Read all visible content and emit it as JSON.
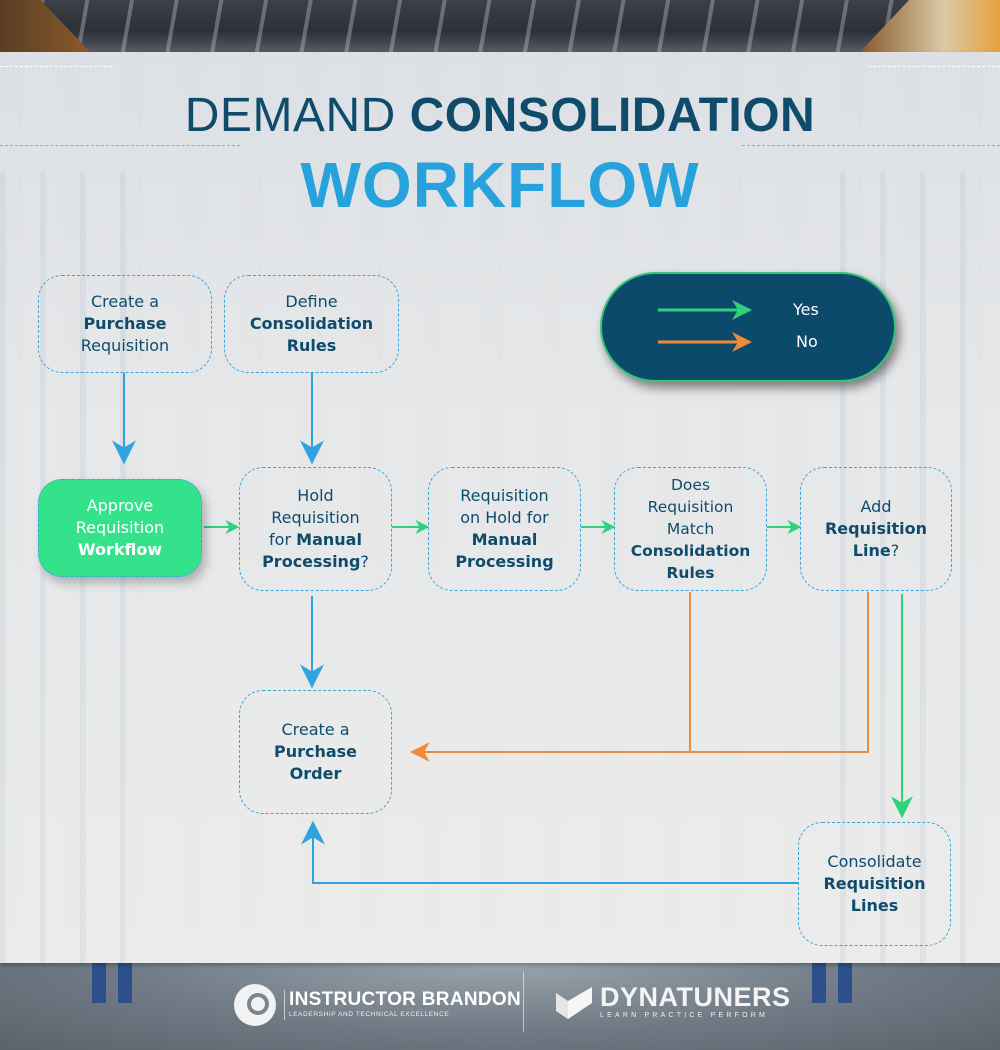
{
  "title": {
    "line1_light": "DEMAND",
    "line1_bold": "CONSOLIDATION",
    "line2": "WORKFLOW"
  },
  "colors": {
    "title_dark": "#0f4c6c",
    "title_accent": "#28a2dc",
    "flow_arrow": "#2ea3dd",
    "yes_arrow": "#2fd17a",
    "no_arrow": "#ee8a3c",
    "node_border": "#3aa7dc",
    "approve_fill": "#35e28c",
    "legend_fill": "#0b4a6a"
  },
  "legend": {
    "yes_label": "Yes",
    "no_label": "No"
  },
  "nodes": {
    "create_requisition": {
      "pre": "Create a",
      "bold": "Purchase",
      "post": "Requisition"
    },
    "define_rules": {
      "pre": "Define",
      "bold": "Consolidation",
      "bold2": "Rules"
    },
    "approve_workflow": {
      "pre": "Approve",
      "mid": "Requisition",
      "bold": "Workflow"
    },
    "hold_requisition": {
      "pre": "Hold",
      "mid": "Requisition",
      "mid2": "for",
      "bold": "Manual",
      "bold2": "Processing",
      "post": "?"
    },
    "on_hold": {
      "pre": "Requisition",
      "mid": "on Hold for",
      "bold": "Manual",
      "bold2": "Processing"
    },
    "match_rules": {
      "pre": "Does",
      "mid": "Requisition",
      "mid2": "Match",
      "bold": "Consolidation",
      "bold2": "Rules"
    },
    "add_line": {
      "pre": "Add",
      "bold": "Requisition",
      "bold2": "Line",
      "post": "?"
    },
    "create_po": {
      "pre": "Create a",
      "bold": "Purchase",
      "bold2": "Order"
    },
    "consolidate_lines": {
      "pre": "Consolidate",
      "bold": "Requisition",
      "bold2": "Lines"
    }
  },
  "footer": {
    "brand1_name": "INSTRUCTOR BRANDON",
    "brand1_tagline": "LEADERSHIP AND TECHNICAL EXCELLENCE",
    "brand2_name": "DYNATUNERS",
    "brand2_tagline": "LEARN PRACTICE PERFORM"
  }
}
